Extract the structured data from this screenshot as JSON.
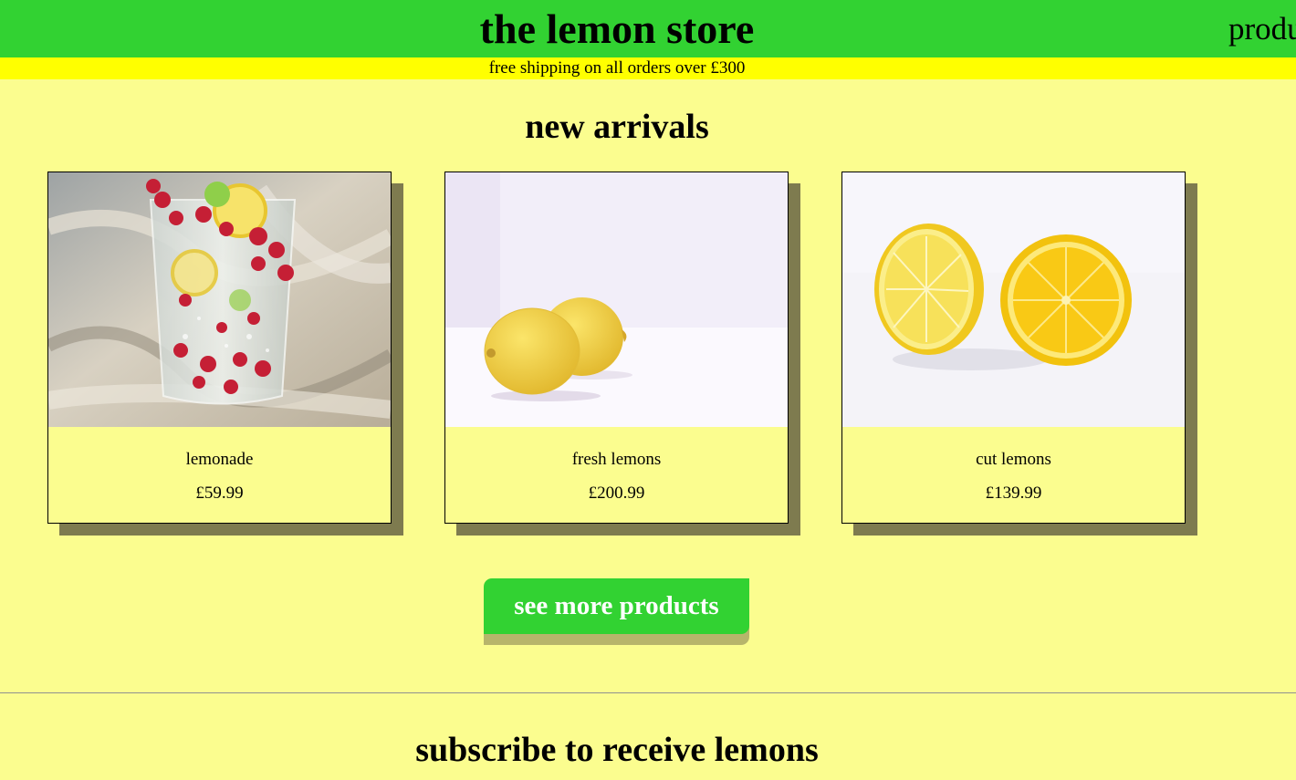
{
  "header": {
    "store_title": "the lemon store",
    "nav_link": "produ"
  },
  "promo_bar": {
    "text": "free shipping on all orders over £300"
  },
  "new_arrivals": {
    "heading": "new arrivals",
    "products": [
      {
        "name": "lemonade",
        "price": "£59.99",
        "image": "lemonade-glass-photo"
      },
      {
        "name": "fresh lemons",
        "price": "£200.99",
        "image": "whole-lemons-photo"
      },
      {
        "name": "cut lemons",
        "price": "£139.99",
        "image": "halved-lemons-photo"
      }
    ],
    "more_button": "see more products"
  },
  "subscribe": {
    "heading": "subscribe to receive lemons"
  },
  "colors": {
    "page_background": "#fbfd8f",
    "header_green": "#32d232",
    "promo_yellow": "#ffff00",
    "card_shadow": "#7e7b4f",
    "button_shadow": "#b7b56b"
  }
}
